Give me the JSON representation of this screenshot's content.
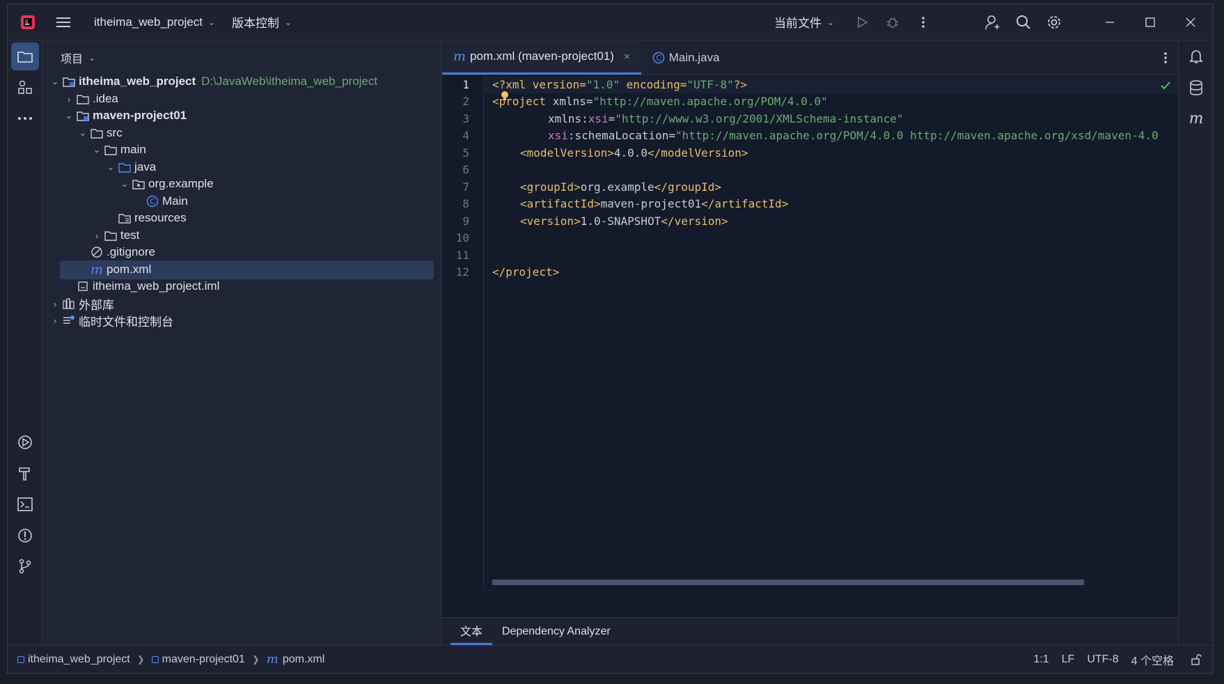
{
  "titlebar": {
    "project_name": "itheima_web_project",
    "vcs_label": "版本控制",
    "run_config": "当前文件"
  },
  "project_panel": {
    "title": "项目",
    "root_name": "itheima_web_project",
    "root_path": "D:\\JavaWeb\\itheima_web_project",
    "items": {
      "idea": ".idea",
      "module": "maven-project01",
      "src": "src",
      "main": "main",
      "java": "java",
      "package": "org.example",
      "main_class": "Main",
      "resources": "resources",
      "test": "test",
      "gitignore": ".gitignore",
      "pom": "pom.xml",
      "iml": "itheima_web_project.iml",
      "ext_libs": "外部库",
      "scratches": "临时文件和控制台"
    }
  },
  "editor": {
    "tabs": [
      {
        "label": "pom.xml (maven-project01)",
        "active": true
      },
      {
        "label": "Main.java",
        "active": false
      }
    ],
    "line_numbers": [
      "1",
      "2",
      "3",
      "4",
      "5",
      "6",
      "7",
      "8",
      "9",
      "10",
      "11",
      "12"
    ],
    "code": {
      "l1_a": "<?xml version=",
      "l1_b": "\"1.0\"",
      "l1_c": " encoding=",
      "l1_d": "\"UTF-8\"",
      "l1_e": "?>",
      "l2_tag": "<project",
      "l2_attr": " xmlns=",
      "l2_val": "\"http://maven.apache.org/POM/4.0.0\"",
      "l3_attr": "xmlns:",
      "l3_ns": "xsi",
      "l3_eq": "=",
      "l3_val": "\"http://www.w3.org/2001/XMLSchema-instance\"",
      "l4_ns": "xsi",
      "l4_attr": ":schemaLocation=",
      "l4_val": "\"http://maven.apache.org/POM/4.0.0 http://maven.apache.org/xsd/maven-4.0",
      "l5_open": "<modelVersion>",
      "l5_text": "4.0.0",
      "l5_close": "</modelVersion>",
      "l7_open": "<groupId>",
      "l7_text": "org.example",
      "l7_close": "</groupId>",
      "l8_open": "<artifactId>",
      "l8_text": "maven-project01",
      "l8_close": "</artifactId>",
      "l9_open": "<version>",
      "l9_text": "1.0-SNAPSHOT",
      "l9_close": "</version>",
      "l12": "</project>"
    },
    "bottom_tabs": [
      "文本",
      "Dependency Analyzer"
    ]
  },
  "statusbar": {
    "crumbs": [
      "itheima_web_project",
      "maven-project01",
      "pom.xml"
    ],
    "position": "1:1",
    "line_sep": "LF",
    "encoding": "UTF-8",
    "indent": "4 个空格"
  },
  "colors": {
    "accent": "#4a7be0",
    "tag": "#e8bf6a",
    "string": "#6aab73",
    "namespace": "#c77dbb",
    "root_path": "#6aab73"
  }
}
